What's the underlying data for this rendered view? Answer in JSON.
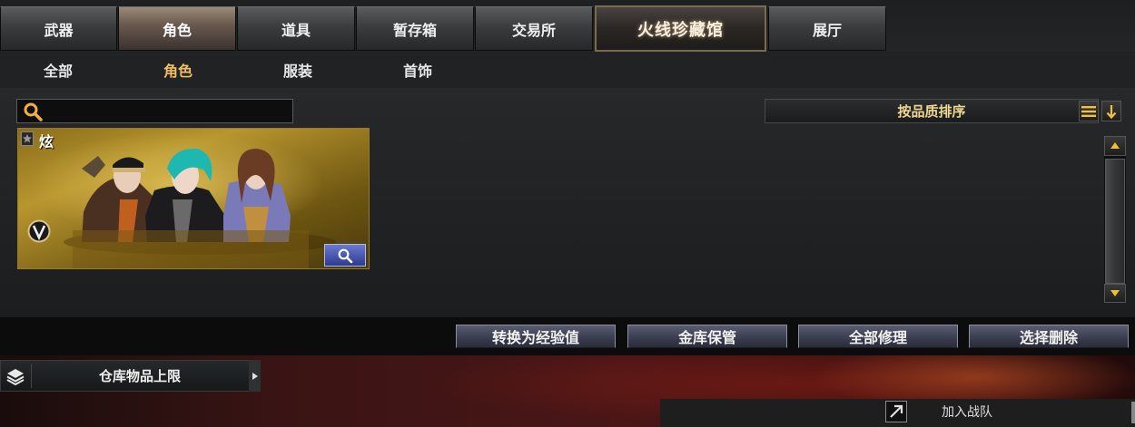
{
  "top_tabs": [
    {
      "label": "武器"
    },
    {
      "label": "角色"
    },
    {
      "label": "道具"
    },
    {
      "label": "暂存箱"
    },
    {
      "label": "交易所"
    },
    {
      "label": "火线珍藏馆"
    },
    {
      "label": "展厅"
    }
  ],
  "active_top_tab": "角色",
  "sub_tabs": [
    {
      "label": "全部"
    },
    {
      "label": "角色"
    },
    {
      "label": "服装"
    },
    {
      "label": "首饰"
    }
  ],
  "active_sub_tab": "角色",
  "search": {
    "value": "",
    "placeholder": ""
  },
  "sort": {
    "label": "按品质排序"
  },
  "items": [
    {
      "title": "炫",
      "badge_icon": "v-badge-icon",
      "quality_color": "#b8952e"
    }
  ],
  "actions": {
    "convert_exp": "转换为经验值",
    "vault": "金库保管",
    "repair_all": "全部修理",
    "select_delete": "选择删除"
  },
  "storage_limit": {
    "label": "仓库物品上限"
  },
  "join_team": {
    "label": "加入战队"
  },
  "colors": {
    "accent_gold": "#f0c060",
    "sort_text": "#f0d890",
    "action_button": "#3e4054"
  }
}
